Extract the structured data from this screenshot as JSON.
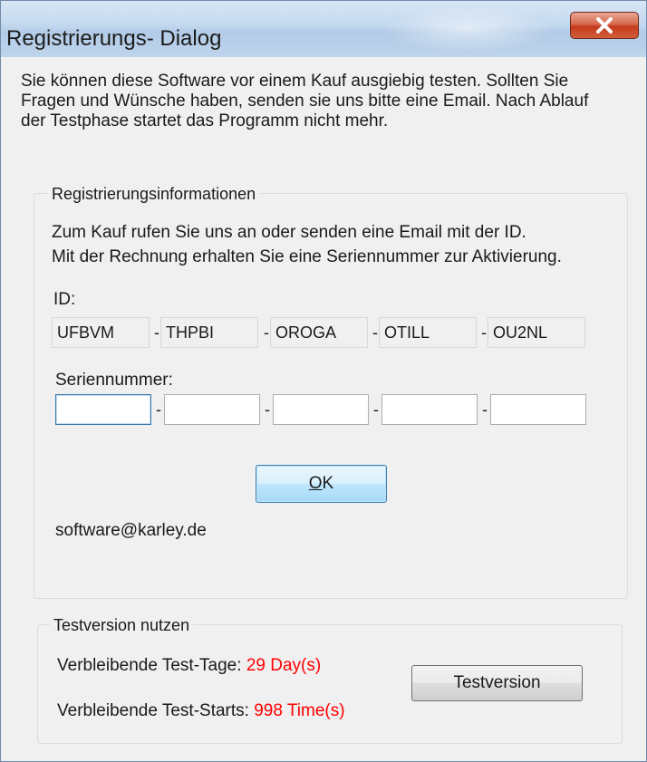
{
  "window": {
    "title": "Registrierungs- Dialog",
    "close_icon": "close-icon"
  },
  "intro": {
    "text": "Sie können diese Software vor einem Kauf ausgiebig testen. Sollten Sie Fragen und Wünsche haben, senden sie uns bitte eine Email. Nach Ablauf der Testphase startet das Programm nicht mehr."
  },
  "registration": {
    "group_title": "Registrierungsinformationen",
    "info_line1": "Zum Kauf rufen Sie uns an oder senden eine Email mit der ID.",
    "info_line2": "Mit der Rechnung erhalten Sie eine Seriennummer zur Aktivierung.",
    "id_label": "ID:",
    "id_parts": [
      "UFBVM",
      "THPBI",
      "OROGA",
      "OTILL",
      "OU2NL"
    ],
    "separator": "-",
    "serial_label": "Seriennummer:",
    "serial_values": [
      "",
      "",
      "",
      "",
      ""
    ],
    "ok_mnemonic": "O",
    "ok_rest": "K",
    "email": "software@karley.de"
  },
  "trial": {
    "group_title": "Testversion nutzen",
    "days_label": "Verbleibende Test-Tage:",
    "days_value": "29 Day(s)",
    "starts_label": "Verbleibende Test-Starts:",
    "starts_value": "998 Time(s)",
    "button_label": "Testversion"
  },
  "colors": {
    "accent_red": "#ff0000",
    "close_button": "#c43a1c",
    "titlebar": "#c2d7ee"
  }
}
